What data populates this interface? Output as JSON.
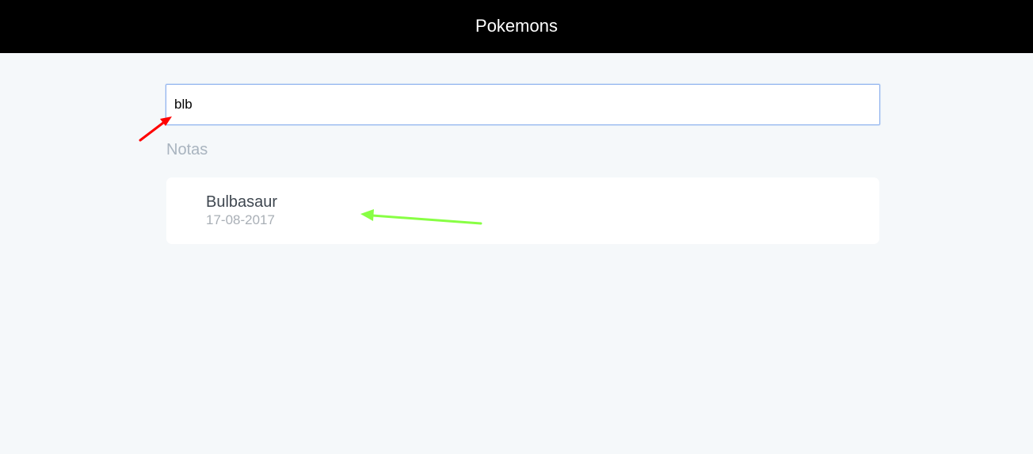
{
  "header": {
    "title": "Pokemons"
  },
  "search": {
    "value": "blb",
    "placeholder": ""
  },
  "notes_section": {
    "label": "Notas",
    "items": [
      {
        "title": "Bulbasaur",
        "date": "17-08-2017"
      }
    ]
  },
  "annotations": {
    "red_arrow_color": "#ff0000",
    "green_arrow_color": "#88ff44"
  }
}
